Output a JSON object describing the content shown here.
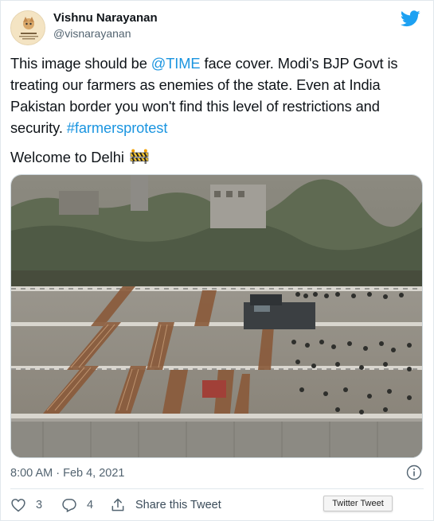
{
  "author": {
    "name": "Vishnu Narayanan",
    "handle": "@visnarayanan"
  },
  "tweet": {
    "text_part1": "This image should be ",
    "mention": "@TIME",
    "text_part2": " face cover. Modi's BJP Govt is treating our farmers as enemies of the state. Even at India Pakistan border you won't find this level of restrictions and security. ",
    "hashtag": "#farmersprotest",
    "welcome": "Welcome to Delhi",
    "emoji": "construction-barrier-icon"
  },
  "photo": {
    "description_icon": "photo-of-barricaded-highway"
  },
  "meta": {
    "timestamp": "8:00 AM · Feb 4, 2021"
  },
  "actions": {
    "likes": "3",
    "replies": "4",
    "share_label": "Share this Tweet"
  },
  "tooltip": {
    "text": "Twitter Tweet"
  },
  "colors": {
    "link": "#1b95e0",
    "twitter_blue": "#1da1f2",
    "secondary_text": "#536471"
  }
}
